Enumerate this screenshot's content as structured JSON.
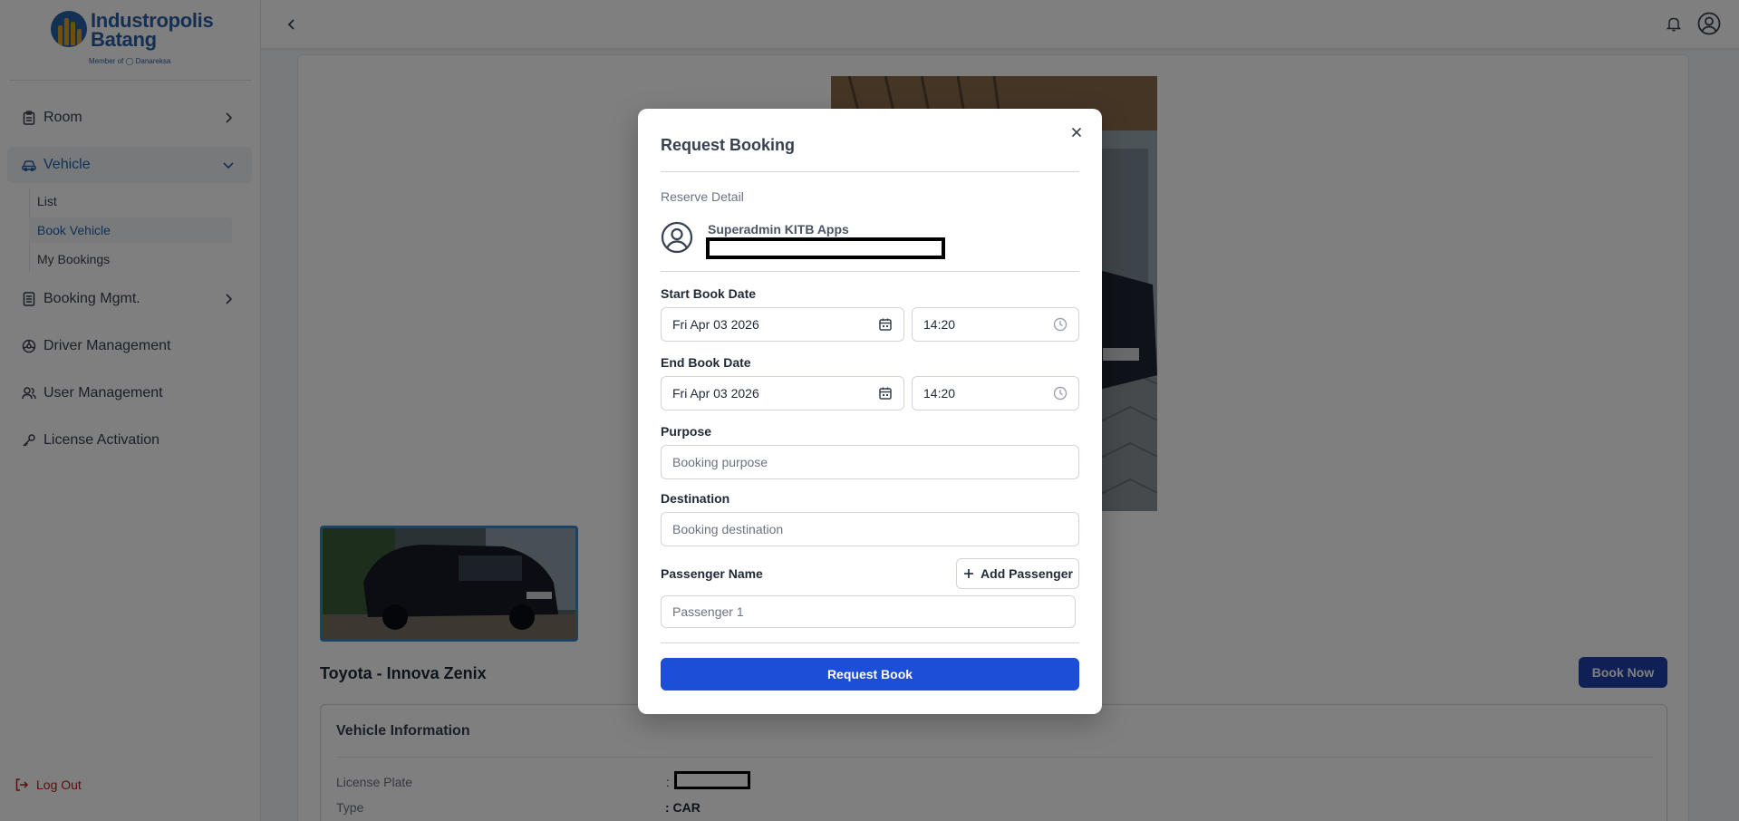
{
  "brand": {
    "name_line1": "Industropolis",
    "name_line2": "Batang",
    "tagline": "Member of ◯ Danareksa"
  },
  "sidebar": {
    "items": [
      {
        "label": "Room",
        "icon": "clipboard-icon"
      },
      {
        "label": "Vehicle",
        "icon": "car-icon"
      },
      {
        "label": "Booking Mgmt.",
        "icon": "document-icon"
      },
      {
        "label": "Driver Management",
        "icon": "steering-wheel-icon"
      },
      {
        "label": "User Management",
        "icon": "users-icon"
      },
      {
        "label": "License Activation",
        "icon": "key-icon"
      }
    ],
    "vehicle_sub": [
      "List",
      "Book Vehicle",
      "My Bookings"
    ],
    "logout": "Log Out"
  },
  "vehicle": {
    "title": "Toyota - Innova Zenix",
    "book_now": "Book Now",
    "info_title": "Vehicle Information",
    "license_plate_label": "License Plate",
    "license_plate_sep": ":",
    "type_label": "Type",
    "type_value": ": CAR"
  },
  "modal": {
    "title": "Request Booking",
    "section": "Reserve Detail",
    "user_name": "Superadmin KITB Apps",
    "start_label": "Start Book Date",
    "start_date": "Fri Apr 03 2026",
    "start_time": "14:20",
    "end_label": "End Book Date",
    "end_date": "Fri Apr 03 2026",
    "end_time": "14:20",
    "purpose_label": "Purpose",
    "purpose_placeholder": "Booking purpose",
    "destination_label": "Destination",
    "destination_placeholder": "Booking destination",
    "passenger_label": "Passenger Name",
    "add_passenger": "Add Passenger",
    "passenger_placeholder": "Passenger 1",
    "submit": "Request Book"
  },
  "colors": {
    "accent": "#2563a8",
    "primary_button": "#1d4ed8",
    "book_now": "#1e40af",
    "logout": "#b91c1c"
  }
}
